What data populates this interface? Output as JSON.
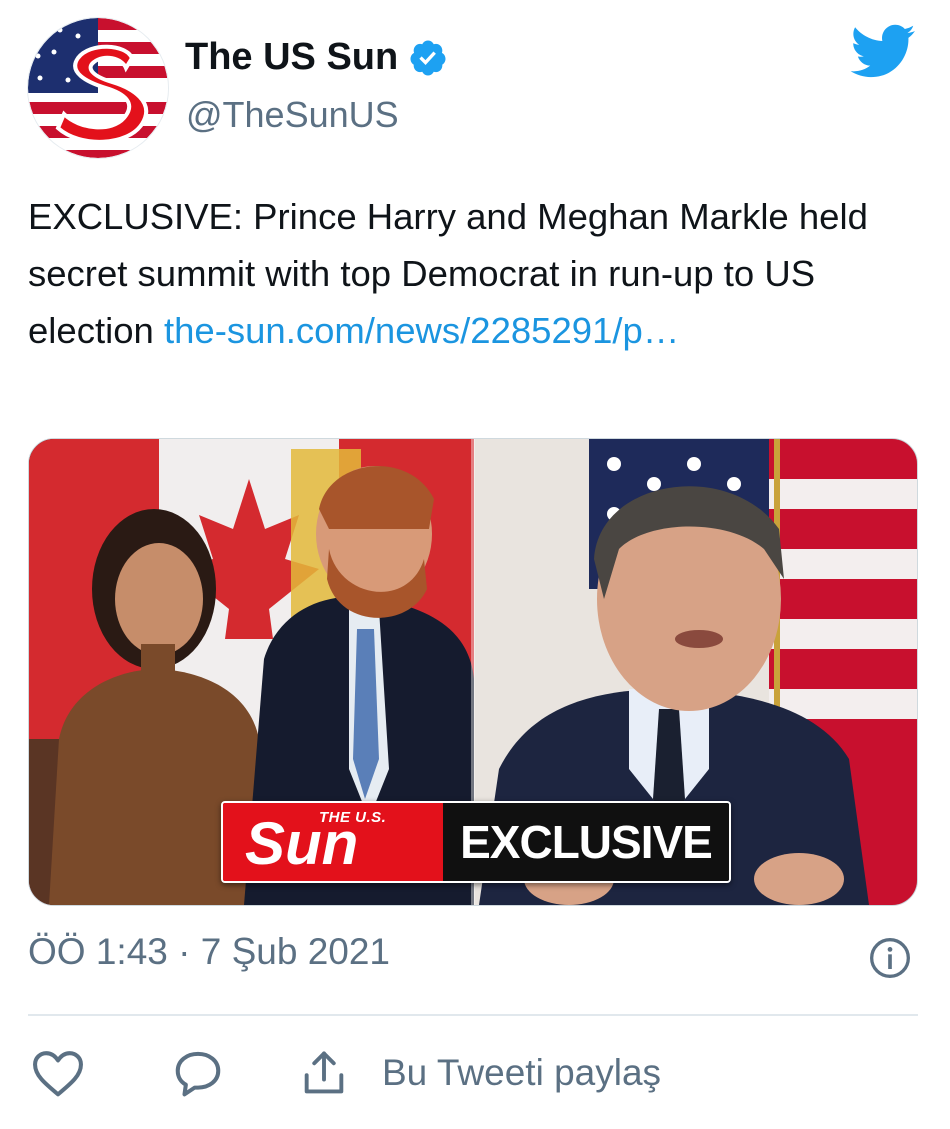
{
  "tweet": {
    "display_name": "The US Sun",
    "handle": "@TheSunUS",
    "verified": true,
    "text": "EXCLUSIVE: Prince Harry and Meghan Markle held secret summit with top Democrat in run-up to US election ",
    "link_text": "the-sun.com/news/2285291/p…",
    "timestamp": "ÖÖ 1:43 · 7 Şub 2021"
  },
  "media": {
    "banner_small": "THE U.S.",
    "banner_brand": "Sun",
    "banner_label": "EXCLUSIVE"
  },
  "actions": {
    "share_label": "Bu Tweeti paylaş"
  },
  "icons": {
    "verified": "verified-badge-icon",
    "platform": "twitter-bird-icon",
    "info": "info-icon",
    "like": "heart-icon",
    "reply": "reply-icon",
    "share": "share-icon"
  },
  "colors": {
    "accent": "#1da1f2",
    "link": "#1b95e0",
    "secondary_text": "#5b7083",
    "sun_red": "#e3111b"
  }
}
